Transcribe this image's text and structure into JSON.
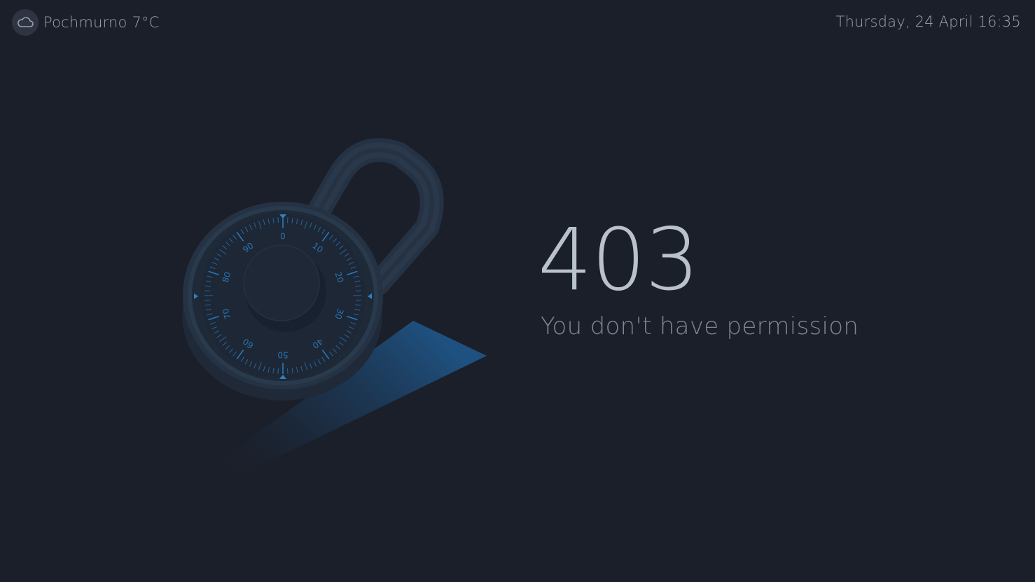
{
  "header": {
    "weather": {
      "icon": "cloud-icon",
      "label": "Pochmurno 7°C"
    },
    "datetime": "Thursday, 24 April 16:35"
  },
  "error": {
    "code": "403",
    "message": "You don't have permission"
  },
  "dial": {
    "numbers": [
      "0",
      "10",
      "20",
      "30",
      "40",
      "50",
      "60",
      "70",
      "80",
      "90"
    ]
  },
  "colors": {
    "background": "#1b1f29",
    "accent": "#2f7fc6",
    "text_primary": "#b9c1cd",
    "text_secondary": "#7f8796"
  }
}
